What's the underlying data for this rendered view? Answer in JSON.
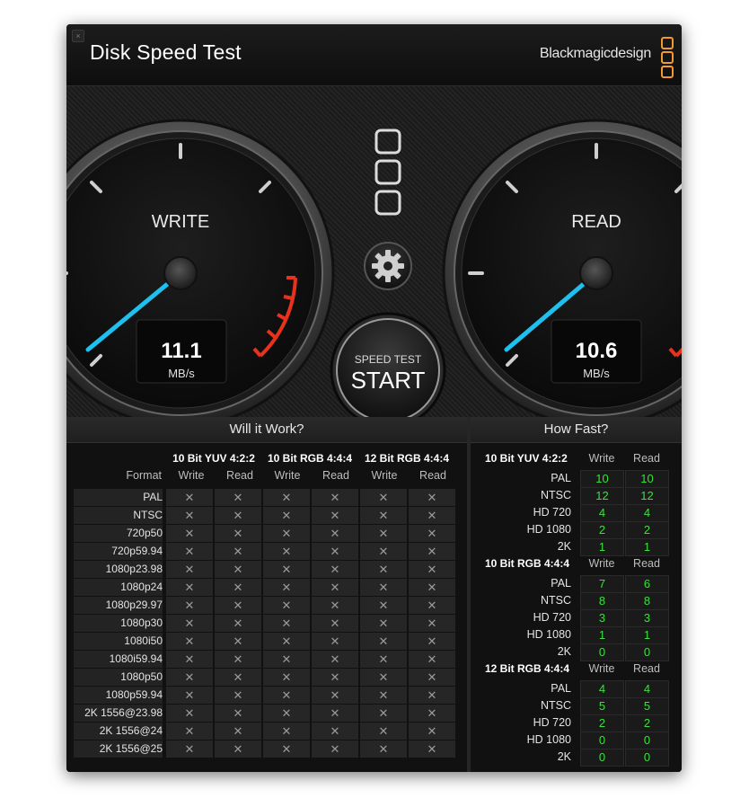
{
  "window": {
    "title": "Disk Speed Test",
    "brand": "Blackmagicdesign",
    "close_glyph": "×"
  },
  "gauges": {
    "write": {
      "label": "WRITE",
      "value": "11.1",
      "unit": "MB/s"
    },
    "read": {
      "label": "READ",
      "value": "10.6",
      "unit": "MB/s"
    }
  },
  "start_button": {
    "caption": "SPEED TEST",
    "label": "START"
  },
  "icons": {
    "settings": "gear-icon",
    "drive_selector": "stacked-squares-icon"
  },
  "colors": {
    "needle": "#1ec0f0",
    "redzone": "#e8321c",
    "ok_value": "#39e23a",
    "brand_accent": "#f29a2e"
  },
  "will_it_work": {
    "title": "Will it Work?",
    "format_header": "Format",
    "groups": [
      "10 Bit YUV 4:2:2",
      "10 Bit RGB 4:4:4",
      "12 Bit RGB 4:4:4"
    ],
    "col_write": "Write",
    "col_read": "Read",
    "fail_mark": "✕",
    "formats": [
      "PAL",
      "NTSC",
      "720p50",
      "720p59.94",
      "1080p23.98",
      "1080p24",
      "1080p29.97",
      "1080p30",
      "1080i50",
      "1080i59.94",
      "1080p50",
      "1080p59.94",
      "2K 1556@23.98",
      "2K 1556@24",
      "2K 1556@25"
    ]
  },
  "how_fast": {
    "title": "How Fast?",
    "col_write": "Write",
    "col_read": "Read",
    "groups": [
      {
        "name": "10 Bit YUV 4:2:2",
        "rows": [
          {
            "format": "PAL",
            "write": "10",
            "read": "10"
          },
          {
            "format": "NTSC",
            "write": "12",
            "read": "12"
          },
          {
            "format": "HD 720",
            "write": "4",
            "read": "4"
          },
          {
            "format": "HD 1080",
            "write": "2",
            "read": "2"
          },
          {
            "format": "2K",
            "write": "1",
            "read": "1"
          }
        ]
      },
      {
        "name": "10 Bit RGB 4:4:4",
        "rows": [
          {
            "format": "PAL",
            "write": "7",
            "read": "6"
          },
          {
            "format": "NTSC",
            "write": "8",
            "read": "8"
          },
          {
            "format": "HD 720",
            "write": "3",
            "read": "3"
          },
          {
            "format": "HD 1080",
            "write": "1",
            "read": "1"
          },
          {
            "format": "2K",
            "write": "0",
            "read": "0"
          }
        ]
      },
      {
        "name": "12 Bit RGB 4:4:4",
        "rows": [
          {
            "format": "PAL",
            "write": "4",
            "read": "4"
          },
          {
            "format": "NTSC",
            "write": "5",
            "read": "5"
          },
          {
            "format": "HD 720",
            "write": "2",
            "read": "2"
          },
          {
            "format": "HD 1080",
            "write": "0",
            "read": "0"
          },
          {
            "format": "2K",
            "write": "0",
            "read": "0"
          }
        ]
      }
    ]
  }
}
